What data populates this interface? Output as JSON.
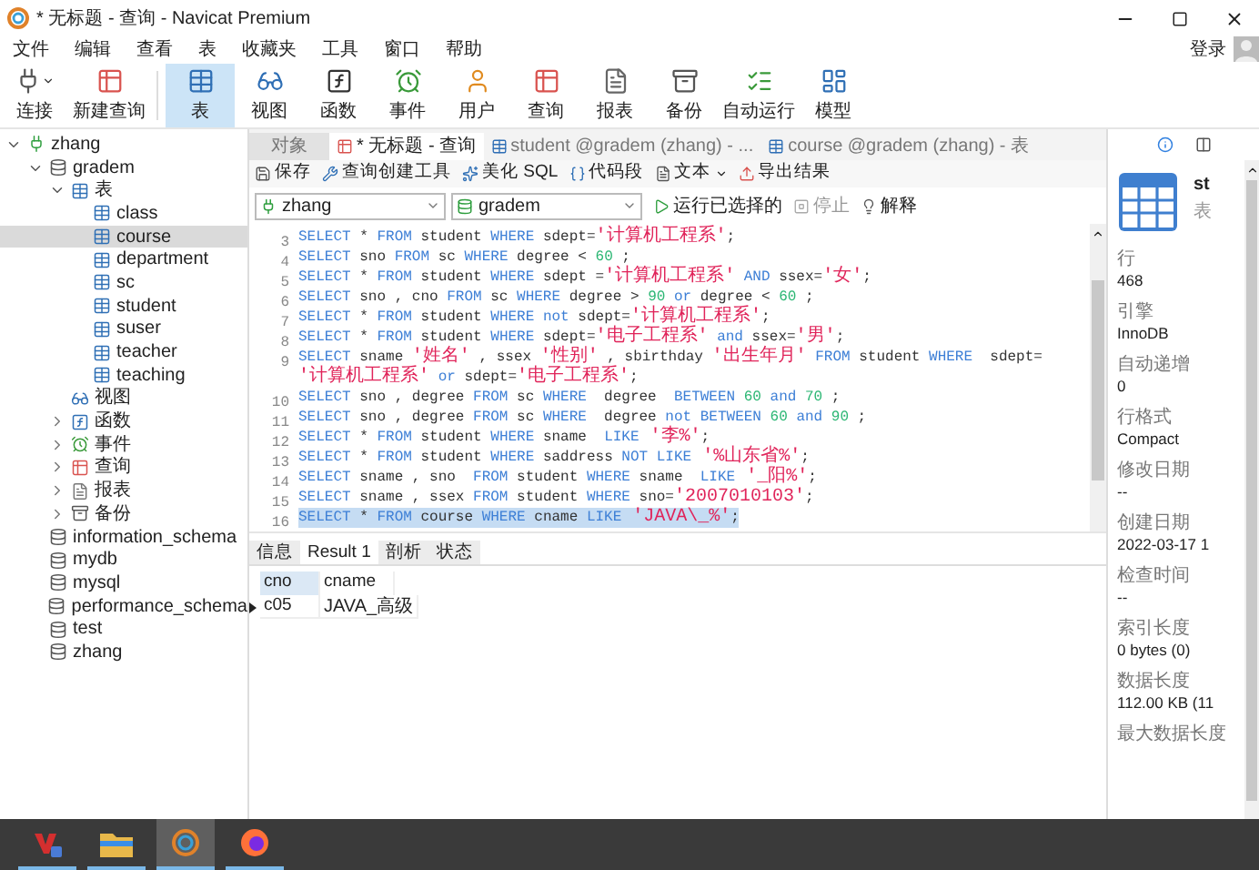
{
  "window": {
    "title": "* 无标题 - 查询 - Navicat Premium",
    "login": "登录"
  },
  "menu": [
    "文件",
    "编辑",
    "查看",
    "表",
    "收藏夹",
    "工具",
    "窗口",
    "帮助"
  ],
  "toolbar": [
    {
      "kind": "connect",
      "label": "连接",
      "selected": false,
      "dropdown": true
    },
    {
      "kind": "new-query",
      "label": "新建查询",
      "selected": false,
      "dropdown": false
    },
    {
      "kind": "table",
      "label": "表",
      "selected": true,
      "dropdown": false
    },
    {
      "kind": "view",
      "label": "视图",
      "selected": false,
      "dropdown": false
    },
    {
      "kind": "function",
      "label": "函数",
      "selected": false,
      "dropdown": false
    },
    {
      "kind": "event",
      "label": "事件",
      "selected": false,
      "dropdown": false
    },
    {
      "kind": "user",
      "label": "用户",
      "selected": false,
      "dropdown": false
    },
    {
      "kind": "query",
      "label": "查询",
      "selected": false,
      "dropdown": false
    },
    {
      "kind": "report",
      "label": "报表",
      "selected": false,
      "dropdown": false
    },
    {
      "kind": "backup",
      "label": "备份",
      "selected": false,
      "dropdown": false
    },
    {
      "kind": "schedule",
      "label": "自动运行",
      "selected": false,
      "dropdown": false
    },
    {
      "kind": "model",
      "label": "模型",
      "selected": false,
      "dropdown": false
    }
  ],
  "sidebar": {
    "items": [
      {
        "kind": "connection",
        "label": "zhang",
        "selected": false,
        "expanded": true,
        "children": [
          {
            "kind": "database",
            "label": "gradem",
            "selected": false,
            "expanded": true,
            "children": [
              {
                "kind": "tables",
                "label": "表",
                "selected": false,
                "expanded": true,
                "children": [
                  {
                    "kind": "table",
                    "label": "class",
                    "selected": false
                  },
                  {
                    "kind": "table",
                    "label": "course",
                    "selected": true
                  },
                  {
                    "kind": "table",
                    "label": "department",
                    "selected": false
                  },
                  {
                    "kind": "table",
                    "label": "sc",
                    "selected": false
                  },
                  {
                    "kind": "table",
                    "label": "student",
                    "selected": false
                  },
                  {
                    "kind": "table",
                    "label": "suser",
                    "selected": false
                  },
                  {
                    "kind": "table",
                    "label": "teacher",
                    "selected": false
                  },
                  {
                    "kind": "table",
                    "label": "teaching",
                    "selected": false
                  }
                ]
              },
              {
                "kind": "views",
                "label": "视图",
                "selected": false
              },
              {
                "kind": "functions",
                "label": "函数",
                "selected": false,
                "expanded": false
              },
              {
                "kind": "events",
                "label": "事件",
                "selected": false,
                "expanded": false
              },
              {
                "kind": "queries",
                "label": "查询",
                "selected": false,
                "expanded": false
              },
              {
                "kind": "reports",
                "label": "报表",
                "selected": false,
                "expanded": false
              },
              {
                "kind": "backups",
                "label": "备份",
                "selected": false,
                "expanded": false
              }
            ]
          },
          {
            "kind": "database",
            "label": "information_schema",
            "selected": false
          },
          {
            "kind": "database",
            "label": "mydb",
            "selected": false
          },
          {
            "kind": "database",
            "label": "mysql",
            "selected": false
          },
          {
            "kind": "database",
            "label": "performance_schema",
            "selected": false
          },
          {
            "kind": "database",
            "label": "test",
            "selected": false
          },
          {
            "kind": "database",
            "label": "zhang",
            "selected": false
          }
        ]
      }
    ]
  },
  "tabs": [
    {
      "kind": "objects",
      "label": "对象",
      "selected": false
    },
    {
      "kind": "query",
      "label": "* 无标题 - 查询",
      "selected": true
    },
    {
      "kind": "table",
      "label": "student @gradem (zhang) - ...",
      "selected": false
    },
    {
      "kind": "table",
      "label": "course @gradem (zhang) - 表",
      "selected": false
    }
  ],
  "editor_toolbar": [
    {
      "kind": "save",
      "label": "保存"
    },
    {
      "kind": "builder",
      "label": "查询创建工具"
    },
    {
      "kind": "beautify",
      "label": "美化 SQL"
    },
    {
      "kind": "snippet",
      "label": "代码段"
    },
    {
      "kind": "text",
      "label": "文本",
      "dropdown": true
    },
    {
      "kind": "export",
      "label": "导出结果"
    }
  ],
  "connection_select": {
    "value": "zhang"
  },
  "database_select": {
    "value": "gradem"
  },
  "run_buttons": [
    {
      "kind": "run",
      "label": "运行已选择的",
      "disabled": false
    },
    {
      "kind": "stop",
      "label": "停止",
      "disabled": true
    },
    {
      "kind": "explain",
      "label": "解释",
      "disabled": false
    }
  ],
  "code_lines": [
    {
      "number": "3",
      "selected": false,
      "tokens": [
        {
          "kind": "keyword",
          "text": "SELECT"
        },
        {
          "kind": "plain",
          "text": " * "
        },
        {
          "kind": "keyword",
          "text": "FROM"
        },
        {
          "kind": "plain",
          "text": " student "
        },
        {
          "kind": "keyword",
          "text": "WHERE"
        },
        {
          "kind": "plain",
          "text": " sdept="
        },
        {
          "kind": "string",
          "text": "'计算机工程系'"
        },
        {
          "kind": "plain",
          "text": ";"
        }
      ]
    },
    {
      "number": "4",
      "selected": false,
      "tokens": [
        {
          "kind": "keyword",
          "text": "SELECT"
        },
        {
          "kind": "plain",
          "text": " sno "
        },
        {
          "kind": "keyword",
          "text": "FROM"
        },
        {
          "kind": "plain",
          "text": " sc "
        },
        {
          "kind": "keyword",
          "text": "WHERE"
        },
        {
          "kind": "plain",
          "text": " degree < "
        },
        {
          "kind": "number",
          "text": "60"
        },
        {
          "kind": "plain",
          "text": " ;"
        }
      ]
    },
    {
      "number": "5",
      "selected": false,
      "tokens": [
        {
          "kind": "keyword",
          "text": "SELECT"
        },
        {
          "kind": "plain",
          "text": " * "
        },
        {
          "kind": "keyword",
          "text": "FROM"
        },
        {
          "kind": "plain",
          "text": " student "
        },
        {
          "kind": "keyword",
          "text": "WHERE"
        },
        {
          "kind": "plain",
          "text": " sdept ="
        },
        {
          "kind": "string",
          "text": "'计算机工程系'"
        },
        {
          "kind": "keyword",
          "text": " AND"
        },
        {
          "kind": "plain",
          "text": " ssex="
        },
        {
          "kind": "string",
          "text": "'女'"
        },
        {
          "kind": "plain",
          "text": ";"
        }
      ]
    },
    {
      "number": "6",
      "selected": false,
      "tokens": [
        {
          "kind": "keyword",
          "text": "SELECT"
        },
        {
          "kind": "plain",
          "text": " sno , cno "
        },
        {
          "kind": "keyword",
          "text": "FROM"
        },
        {
          "kind": "plain",
          "text": " sc "
        },
        {
          "kind": "keyword",
          "text": "WHERE"
        },
        {
          "kind": "plain",
          "text": " degree > "
        },
        {
          "kind": "number",
          "text": "90"
        },
        {
          "kind": "keyword",
          "text": " or"
        },
        {
          "kind": "plain",
          "text": " degree < "
        },
        {
          "kind": "number",
          "text": "60"
        },
        {
          "kind": "plain",
          "text": " ;"
        }
      ]
    },
    {
      "number": "7",
      "selected": false,
      "tokens": [
        {
          "kind": "keyword",
          "text": "SELECT"
        },
        {
          "kind": "plain",
          "text": " * "
        },
        {
          "kind": "keyword",
          "text": "FROM"
        },
        {
          "kind": "plain",
          "text": " student "
        },
        {
          "kind": "keyword",
          "text": "WHERE"
        },
        {
          "kind": "keyword",
          "text": " not"
        },
        {
          "kind": "plain",
          "text": " sdept="
        },
        {
          "kind": "string",
          "text": "'计算机工程系'"
        },
        {
          "kind": "plain",
          "text": ";"
        }
      ]
    },
    {
      "number": "8",
      "selected": false,
      "tokens": [
        {
          "kind": "keyword",
          "text": "SELECT"
        },
        {
          "kind": "plain",
          "text": " * "
        },
        {
          "kind": "keyword",
          "text": "FROM"
        },
        {
          "kind": "plain",
          "text": " student "
        },
        {
          "kind": "keyword",
          "text": "WHERE"
        },
        {
          "kind": "plain",
          "text": " sdept="
        },
        {
          "kind": "string",
          "text": "'电子工程系'"
        },
        {
          "kind": "keyword",
          "text": " and"
        },
        {
          "kind": "plain",
          "text": " ssex="
        },
        {
          "kind": "string",
          "text": "'男'"
        },
        {
          "kind": "plain",
          "text": ";"
        }
      ]
    },
    {
      "number": "9",
      "selected": false,
      "tokens": [
        {
          "kind": "keyword",
          "text": "SELECT"
        },
        {
          "kind": "plain",
          "text": " sname "
        },
        {
          "kind": "string",
          "text": "'姓名'"
        },
        {
          "kind": "plain",
          "text": " , ssex "
        },
        {
          "kind": "string",
          "text": "'性别'"
        },
        {
          "kind": "plain",
          "text": " , sbirthday "
        },
        {
          "kind": "string",
          "text": "'出生年月'"
        },
        {
          "kind": "keyword",
          "text": " FROM"
        },
        {
          "kind": "plain",
          "text": " student "
        },
        {
          "kind": "keyword",
          "text": "WHERE"
        },
        {
          "kind": "plain",
          "text": "  sdept="
        }
      ]
    },
    {
      "selected": false,
      "tokens": [
        {
          "kind": "string",
          "text": "'计算机工程系'"
        },
        {
          "kind": "keyword",
          "text": " or"
        },
        {
          "kind": "plain",
          "text": " sdept="
        },
        {
          "kind": "string",
          "text": "'电子工程系'"
        },
        {
          "kind": "plain",
          "text": ";"
        }
      ]
    },
    {
      "number": "10",
      "selected": false,
      "tokens": [
        {
          "kind": "keyword",
          "text": "SELECT"
        },
        {
          "kind": "plain",
          "text": " sno , degree "
        },
        {
          "kind": "keyword",
          "text": "FROM"
        },
        {
          "kind": "plain",
          "text": " sc "
        },
        {
          "kind": "keyword",
          "text": "WHERE"
        },
        {
          "kind": "plain",
          "text": "  degree  "
        },
        {
          "kind": "keyword",
          "text": "BETWEEN"
        },
        {
          "kind": "number",
          "text": " 60"
        },
        {
          "kind": "keyword",
          "text": " and"
        },
        {
          "kind": "number",
          "text": " 70"
        },
        {
          "kind": "plain",
          "text": " ;"
        }
      ]
    },
    {
      "number": "11",
      "selected": false,
      "tokens": [
        {
          "kind": "keyword",
          "text": "SELECT"
        },
        {
          "kind": "plain",
          "text": " sno , degree "
        },
        {
          "kind": "keyword",
          "text": "FROM"
        },
        {
          "kind": "plain",
          "text": " sc "
        },
        {
          "kind": "keyword",
          "text": "WHERE"
        },
        {
          "kind": "plain",
          "text": "  degree "
        },
        {
          "kind": "keyword",
          "text": "not BETWEEN"
        },
        {
          "kind": "number",
          "text": " 60"
        },
        {
          "kind": "keyword",
          "text": " and"
        },
        {
          "kind": "number",
          "text": " 90"
        },
        {
          "kind": "plain",
          "text": " ;"
        }
      ]
    },
    {
      "number": "12",
      "selected": false,
      "tokens": [
        {
          "kind": "keyword",
          "text": "SELECT"
        },
        {
          "kind": "plain",
          "text": " * "
        },
        {
          "kind": "keyword",
          "text": "FROM"
        },
        {
          "kind": "plain",
          "text": " student "
        },
        {
          "kind": "keyword",
          "text": "WHERE"
        },
        {
          "kind": "plain",
          "text": " sname  "
        },
        {
          "kind": "keyword",
          "text": "LIKE"
        },
        {
          "kind": "string",
          "text": " '李%'"
        },
        {
          "kind": "plain",
          "text": ";"
        }
      ]
    },
    {
      "number": "13",
      "selected": false,
      "tokens": [
        {
          "kind": "keyword",
          "text": "SELECT"
        },
        {
          "kind": "plain",
          "text": " * "
        },
        {
          "kind": "keyword",
          "text": "FROM"
        },
        {
          "kind": "plain",
          "text": " student "
        },
        {
          "kind": "keyword",
          "text": "WHERE"
        },
        {
          "kind": "plain",
          "text": " saddress "
        },
        {
          "kind": "keyword",
          "text": "NOT LIKE"
        },
        {
          "kind": "string",
          "text": " '%山东省%'"
        },
        {
          "kind": "plain",
          "text": ";"
        }
      ]
    },
    {
      "number": "14",
      "selected": false,
      "tokens": [
        {
          "kind": "keyword",
          "text": "SELECT"
        },
        {
          "kind": "plain",
          "text": " sname , sno  "
        },
        {
          "kind": "keyword",
          "text": "FROM"
        },
        {
          "kind": "plain",
          "text": " student "
        },
        {
          "kind": "keyword",
          "text": "WHERE"
        },
        {
          "kind": "plain",
          "text": " sname  "
        },
        {
          "kind": "keyword",
          "text": "LIKE"
        },
        {
          "kind": "string",
          "text": " '_阳%'"
        },
        {
          "kind": "plain",
          "text": ";"
        }
      ]
    },
    {
      "number": "15",
      "selected": false,
      "tokens": [
        {
          "kind": "keyword",
          "text": "SELECT"
        },
        {
          "kind": "plain",
          "text": " sname , ssex "
        },
        {
          "kind": "keyword",
          "text": "FROM"
        },
        {
          "kind": "plain",
          "text": " student "
        },
        {
          "kind": "keyword",
          "text": "WHERE"
        },
        {
          "kind": "plain",
          "text": " sno="
        },
        {
          "kind": "string",
          "text": "'2007010103'"
        },
        {
          "kind": "plain",
          "text": ";"
        }
      ]
    },
    {
      "number": "16",
      "selected": true,
      "tokens": [
        {
          "kind": "keyword",
          "text": "SELECT"
        },
        {
          "kind": "plain",
          "text": " * "
        },
        {
          "kind": "keyword",
          "text": "FROM"
        },
        {
          "kind": "plain",
          "text": " course "
        },
        {
          "kind": "keyword",
          "text": "WHERE"
        },
        {
          "kind": "plain",
          "text": " cname "
        },
        {
          "kind": "keyword",
          "text": "LIKE"
        },
        {
          "kind": "string",
          "text": " 'JAVA\\_%'"
        },
        {
          "kind": "plain",
          "text": ";"
        }
      ]
    }
  ],
  "result_tabs": [
    {
      "label": "信息",
      "selected": false
    },
    {
      "label": "Result 1",
      "selected": true
    },
    {
      "label": "剖析",
      "selected": false
    },
    {
      "label": "状态",
      "selected": false
    }
  ],
  "result_table": {
    "columns": [
      {
        "label": "cno",
        "selected": true
      },
      {
        "label": "cname",
        "selected": false
      }
    ],
    "rows": [
      {
        "current": true,
        "cells": [
          "c05",
          "JAVA_高级"
        ]
      }
    ]
  },
  "info_panel": {
    "title": "st",
    "subtitle": "表",
    "properties": [
      {
        "label": "行",
        "value": "468"
      },
      {
        "label": "引擎",
        "value": "InnoDB"
      },
      {
        "label": "自动递增",
        "value": "0"
      },
      {
        "label": "行格式",
        "value": "Compact"
      },
      {
        "label": "修改日期",
        "value": "--"
      },
      {
        "label": "创建日期",
        "value": "2022-03-17 1"
      },
      {
        "label": "检查时间",
        "value": "--"
      },
      {
        "label": "索引长度",
        "value": "0 bytes (0)"
      },
      {
        "label": "数据长度",
        "value": "112.00 KB (11"
      },
      {
        "label": "最大数据长度"
      }
    ]
  },
  "taskbar": [
    {
      "kind": "office",
      "selected": false
    },
    {
      "kind": "folder",
      "selected": false
    },
    {
      "kind": "navicat",
      "selected": true
    },
    {
      "kind": "browser",
      "selected": false
    }
  ]
}
